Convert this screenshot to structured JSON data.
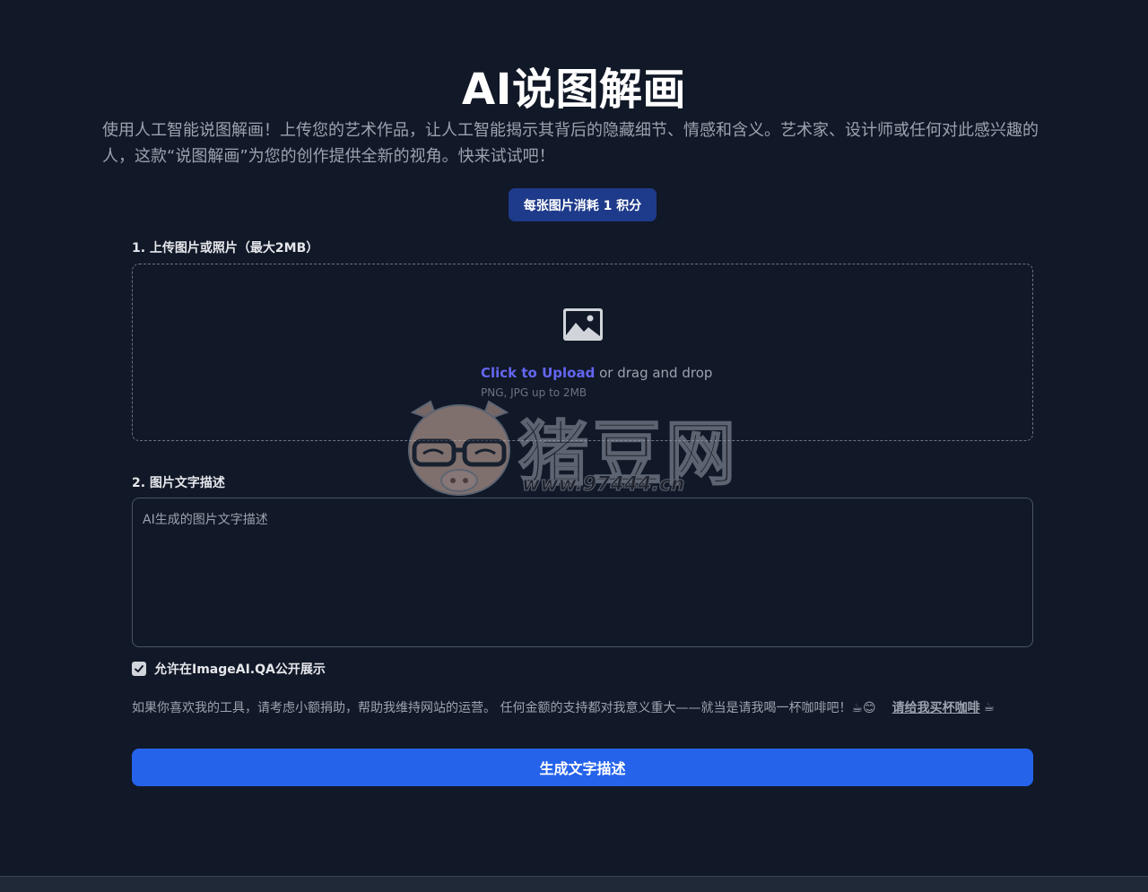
{
  "header": {
    "title": "AI说图解画",
    "intro": "使用人工智能说图解画！上传您的艺术作品，让人工智能揭示其背后的隐藏细节、情感和含义。艺术家、设计师或任何对此感兴趣的人，这款“说图解画”为您的创作提供全新的视角。快来试试吧！",
    "credit_badge": "每张图片消耗 1 积分"
  },
  "upload": {
    "label": "1. 上传图片或照片（最大2MB）",
    "icon": "image-icon",
    "link_text": "Click to Upload",
    "rest_text": " or drag and drop",
    "hint": "PNG, JPG up to 2MB"
  },
  "description": {
    "label": "2. 图片文字描述",
    "placeholder": "AI生成的图片文字描述",
    "value": ""
  },
  "public_option": {
    "checked": true,
    "label": "允许在ImageAI.QA公开展示"
  },
  "donate": {
    "text": "如果你喜欢我的工具，请考虑小额捐助，帮助我维持网站的运营。 任何金额的支持都对我意义重大——就当是请我喝一杯咖啡吧！☕😊",
    "link_text": "请给我买杯咖啡",
    "link_icon": "☕"
  },
  "generate_button": "生成文字描述",
  "watermark": {
    "main": "猪豆网",
    "url": "www.97444.cn"
  },
  "colors": {
    "background": "#111827",
    "primary_button": "#2563eb",
    "badge": "#1e3a8a",
    "link": "#6366f1"
  }
}
